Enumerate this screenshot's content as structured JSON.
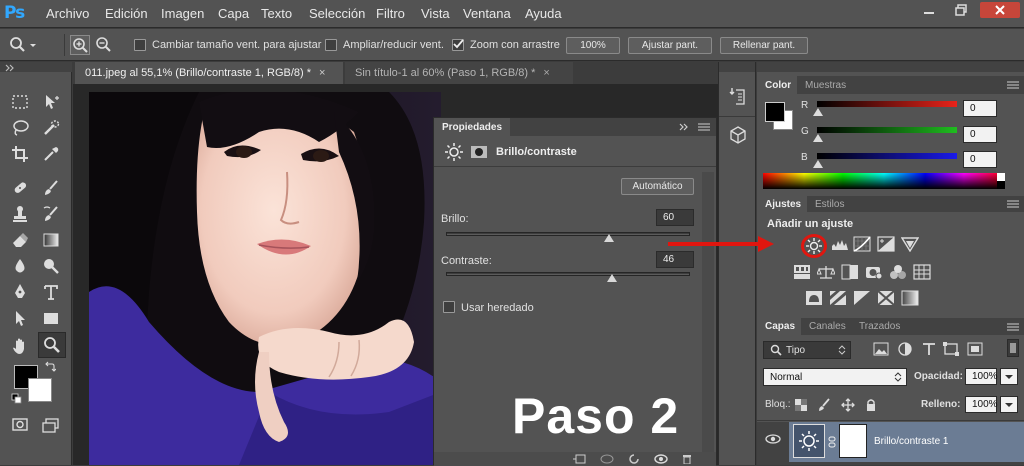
{
  "app": {
    "logo": "Ps"
  },
  "menu": [
    "Archivo",
    "Edición",
    "Imagen",
    "Capa",
    "Texto",
    "Selección",
    "Filtro",
    "Vista",
    "Ventana",
    "Ayuda"
  ],
  "options": {
    "chk_resize": "Cambiar tamaño vent. para ajustar",
    "chk_zoom_all": "Ampliar/reducir vent.",
    "chk_scrubby": "Zoom con arrastre",
    "btn_100": "100%",
    "btn_fit": "Ajustar pant.",
    "btn_fill": "Rellenar pant."
  },
  "tabs": [
    {
      "label": "011.jpeg al 55,1% (Brillo/contraste 1, RGB/8) *",
      "close": "×"
    },
    {
      "label": "Sin título-1 al 60% (Paso 1, RGB/8) *",
      "close": "×"
    }
  ],
  "properties": {
    "title": "Propiedades",
    "heading": "Brillo/contraste",
    "auto_button": "Automático",
    "brightness_label": "Brillo:",
    "brightness_value": "60",
    "brightness_fraction": 0.67,
    "contrast_label": "Contraste:",
    "contrast_value": "46",
    "contrast_fraction": 0.68,
    "legacy_label": "Usar heredado"
  },
  "overlay": {
    "step_text": "Paso 2"
  },
  "color_panel": {
    "tab_active": "Color",
    "tab_inactive": "Muestras",
    "channels": [
      {
        "label": "R",
        "value": "0",
        "color": "#e8231a"
      },
      {
        "label": "G",
        "value": "0",
        "color": "#1fbd1f"
      },
      {
        "label": "B",
        "value": "0",
        "color": "#1a1ae8"
      }
    ]
  },
  "adjust_panel": {
    "tab_active": "Ajustes",
    "tab_inactive": "Estilos",
    "heading": "Añadir un ajuste"
  },
  "layers_panel": {
    "tab_active": "Capas",
    "tab_2": "Canales",
    "tab_3": "Trazados",
    "filter_kind": "Tipo",
    "blend_mode": "Normal",
    "opacity_label": "Opacidad:",
    "opacity_value": "100%",
    "lock_label": "Bloq.:",
    "fill_label": "Relleno:",
    "fill_value": "100%",
    "layer_name": "Brillo/contraste 1"
  },
  "colors": {
    "accent_red": "#e0160f",
    "selected_layer": "#6b7c94",
    "ps_blue": "#31a8ff"
  }
}
